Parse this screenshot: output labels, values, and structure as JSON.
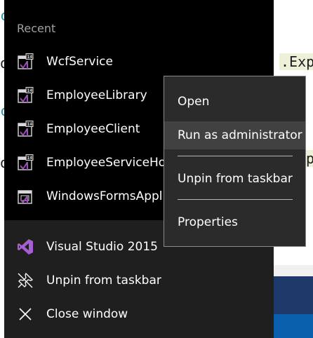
{
  "background": {
    "code_fragments": [
      ".Exp",
      "p"
    ],
    "left_fragments": [
      "c",
      "o",
      "c",
      "o"
    ]
  },
  "jumplist": {
    "section_title": "Recent",
    "recent": [
      {
        "label": "WcfService",
        "icon": "visual-studio-project-icon"
      },
      {
        "label": "EmployeeLibrary",
        "icon": "visual-studio-project-icon"
      },
      {
        "label": "EmployeeClient",
        "icon": "visual-studio-project-icon"
      },
      {
        "label": "EmployeeServiceHost",
        "icon": "visual-studio-project-icon"
      },
      {
        "label": "WindowsFormsApplication",
        "icon": "visual-studio-form-icon"
      }
    ],
    "tasks": [
      {
        "label": "Visual Studio 2015",
        "icon": "visual-studio-logo-icon"
      },
      {
        "label": "Unpin from taskbar",
        "icon": "unpin-icon"
      },
      {
        "label": "Close window",
        "icon": "close-icon"
      }
    ]
  },
  "context_menu": {
    "items": [
      "Open",
      "Run as administrator",
      "Unpin from taskbar",
      "Properties"
    ],
    "hovered": "Run as administrator"
  },
  "colors": {
    "jumplist_bg": "#000000",
    "tasks_bg": "#1f1f1f",
    "menu_bg": "#2b2b2b",
    "menu_hover": "#414141",
    "vs_purple": "#68217a",
    "taskbar_blue": "#0a5fad"
  }
}
